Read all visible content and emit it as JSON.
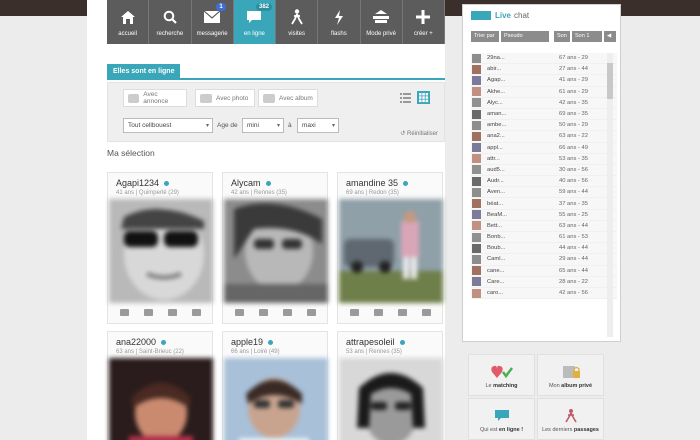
{
  "nav": [
    {
      "label": "accueil",
      "icon": "home-icon"
    },
    {
      "label": "recherche",
      "icon": "search-icon"
    },
    {
      "label": "messagerie",
      "icon": "mail-icon",
      "badge": "1"
    },
    {
      "label": "en ligne",
      "icon": "chat-bubble-icon",
      "badge": "382",
      "active": true
    },
    {
      "label": "visites",
      "icon": "visitors-icon"
    },
    {
      "label": "flashs",
      "icon": "flash-icon"
    },
    {
      "label": "Mode privé",
      "icon": "private-mode-icon"
    },
    {
      "label": "créer +",
      "icon": "plus-icon"
    }
  ],
  "tab": {
    "label": "Elles sont en ligne"
  },
  "filters": {
    "with_ad": "Avec annonce",
    "with_photo": "Avec photo",
    "with_album": "Avec album",
    "region": "Tout cellbouest",
    "age_label": "Age de",
    "age_min": "mini",
    "age_to": "à",
    "age_max": "maxi",
    "reset": "Réinitialiser"
  },
  "section_title": "Ma sélection",
  "profiles": [
    {
      "name": "Agapi1234",
      "meta": "41 ans | Quimperlé (29)"
    },
    {
      "name": "Alycam",
      "meta": "42 ans | Rennes (35)"
    },
    {
      "name": "amandine 35",
      "meta": "69 ans | Redon (35)"
    },
    {
      "name": "ana22000",
      "meta": "63 ans | Saint-Brieuc (22)"
    },
    {
      "name": "apple19",
      "meta": "66 ans | Loiré (49)"
    },
    {
      "name": "attrapesoleil",
      "meta": "53 ans | Rennes (35)"
    }
  ],
  "chat": {
    "title_live": "Live",
    "title_chat": "chat",
    "filter_by": "Trier par",
    "filter_value": "Pseudo",
    "sound_label": "Son",
    "sound_value": "Son 1",
    "users": [
      {
        "name": "29na...",
        "info": "67 ans - 29"
      },
      {
        "name": "abir...",
        "info": "27 ans - 44"
      },
      {
        "name": "Agap...",
        "info": "41 ans - 29"
      },
      {
        "name": "Akhe...",
        "info": "61 ans - 29"
      },
      {
        "name": "Alyc...",
        "info": "42 ans - 35"
      },
      {
        "name": "aman...",
        "info": "69 ans - 35"
      },
      {
        "name": "ambe...",
        "info": "50 ans - 29"
      },
      {
        "name": "ana2...",
        "info": "63 ans - 22"
      },
      {
        "name": "appl...",
        "info": "66 ans - 49"
      },
      {
        "name": "attr...",
        "info": "53 ans - 35"
      },
      {
        "name": "aud5...",
        "info": "30 ans - 56"
      },
      {
        "name": "Audr...",
        "info": "40 ans - 56"
      },
      {
        "name": "Aven...",
        "info": "59 ans - 44"
      },
      {
        "name": "béat...",
        "info": "37 ans - 35"
      },
      {
        "name": "BeaM...",
        "info": "55 ans - 25"
      },
      {
        "name": "Bett...",
        "info": "63 ans - 44"
      },
      {
        "name": "Bonb...",
        "info": "61 ans - 53"
      },
      {
        "name": "Boub...",
        "info": "44 ans - 44"
      },
      {
        "name": "Caml...",
        "info": "29 ans - 44"
      },
      {
        "name": "cane...",
        "info": "65 ans - 44"
      },
      {
        "name": "Care...",
        "info": "28 ans - 22"
      },
      {
        "name": "caro...",
        "info": "42 ans - 56"
      }
    ]
  },
  "widgets": [
    {
      "pre": "Le ",
      "bold": "matching",
      "post": "",
      "icon": "heart-check-icon"
    },
    {
      "pre": "Mon ",
      "bold": "album privé",
      "post": "",
      "icon": "private-album-icon"
    },
    {
      "pre": "Qui est ",
      "bold": "en ligne !",
      "post": "",
      "icon": "online-icon"
    },
    {
      "pre": "Les derniers ",
      "bold": "passages",
      "post": "",
      "icon": "visits-icon"
    }
  ]
}
